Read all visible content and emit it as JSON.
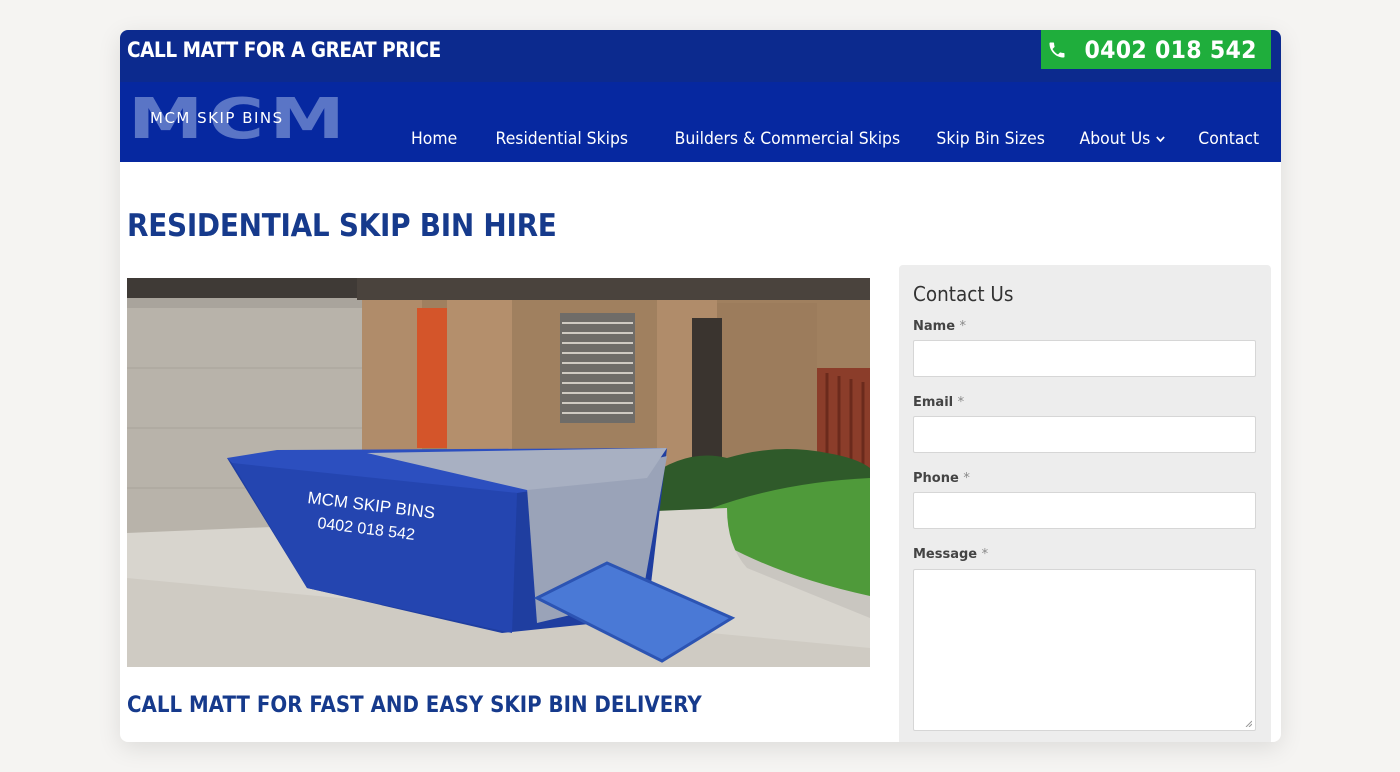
{
  "topbar": {
    "tagline": "CALL MATT FOR A GREAT PRICE",
    "phone_number": "0402 018 542"
  },
  "header": {
    "logo_big": "MCM",
    "logo_small": "MCM SKIP BINS",
    "nav": [
      {
        "label": "Home"
      },
      {
        "label": "Residential Skips"
      },
      {
        "label": "Builders & Commercial Skips"
      },
      {
        "label": "Skip Bin Sizes"
      },
      {
        "label": "About Us"
      },
      {
        "label": "Contact"
      }
    ]
  },
  "main": {
    "title": "RESIDENTIAL SKIP BIN HIRE",
    "hero_bin_text_1": "MCM SKIP BINS",
    "hero_bin_text_2": "0402 018 542",
    "subheading": "CALL MATT FOR FAST AND EASY SKIP BIN DELIVERY"
  },
  "contact_form": {
    "title": "Contact Us",
    "fields": [
      {
        "label": "Name",
        "required_mark": "*",
        "value": ""
      },
      {
        "label": "Email",
        "required_mark": "*",
        "value": ""
      },
      {
        "label": "Phone",
        "required_mark": "*",
        "value": ""
      },
      {
        "label": "Message",
        "required_mark": "*",
        "value": ""
      }
    ]
  },
  "colors": {
    "header_blue": "#0628a0",
    "topbar_blue": "#0c2a8e",
    "phone_green": "#1fae3c",
    "title_blue": "#163a8c"
  }
}
